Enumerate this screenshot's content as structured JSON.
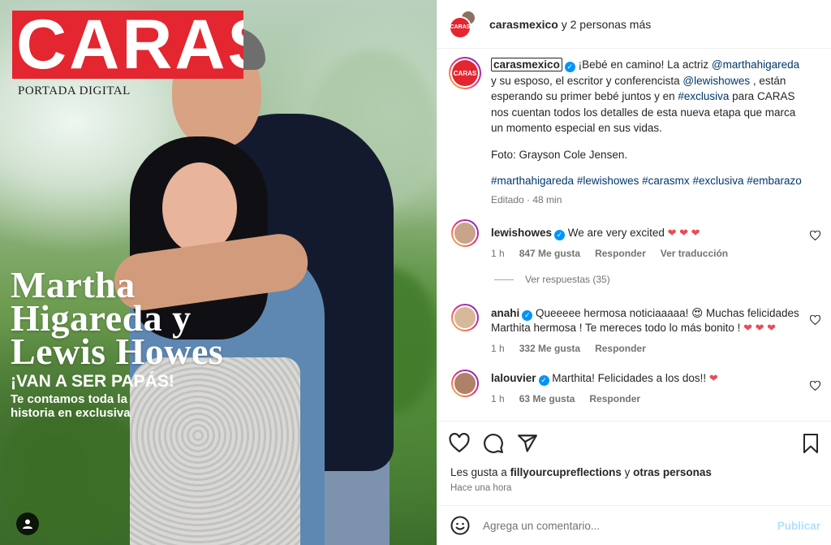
{
  "cover": {
    "brand": "CARAS",
    "edition": "PORTADA DIGITAL",
    "headline_lines": [
      "Martha",
      "Higareda y",
      "Lewis Howes"
    ],
    "subheadline": "¡VAN A SER PAPÁS!",
    "tagline": "Te contamos toda la historia en exclusiva"
  },
  "header": {
    "avatar_text": "CARAS",
    "account": "carasmexico",
    "rest": " y 2 personas más"
  },
  "caption": {
    "avatar_text": "CARAS",
    "username": "carasmexico",
    "text_1": "¡Bebé en camino! La actriz ",
    "mention_1": "@marthahigareda",
    "text_2": " y su esposo, el escritor y conferencista ",
    "mention_2": "@lewishowes",
    "text_3": " , están esperando su primer bebé juntos y en ",
    "hashtag_1": "#exclusiva",
    "text_4": " para CARAS nos cuentan todos los detalles de esta nueva etapa que marca un momento especial en sus vidas.",
    "credit": "Foto: Grayson Cole Jensen.",
    "hashtags": [
      "#marthahigareda",
      "#lewishowes",
      "#carasmx",
      "#exclusiva",
      "#embarazo"
    ],
    "meta": "Editado · 48 min"
  },
  "comments": [
    {
      "username": "lewishowes",
      "text": "We are very excited",
      "emojis": "❤ ❤ ❤",
      "time": "1 h",
      "likes": "847 Me gusta",
      "reply": "Responder",
      "translate": "Ver traducción",
      "avatar_color": "#c9a48a"
    },
    {
      "username": "anahi",
      "text": "Queeeee hermosa noticiaaaaa! 😍 Muchas felicidades Marthita hermosa ! Te mereces todo lo más bonito ! ",
      "emojis": "❤ ❤ ❤",
      "time": "1 h",
      "likes": "332 Me gusta",
      "reply": "Responder",
      "avatar_color": "#d8b89a"
    },
    {
      "username": "lalouvier",
      "text": "Marthita! Felicidades a los dos!! ",
      "emojis": "❤",
      "time": "1 h",
      "likes": "63 Me gusta",
      "reply": "Responder",
      "avatar_color": "#b08068"
    }
  ],
  "replies_toggle": "Ver respuestas (35)",
  "actions": {
    "likes_prefix": "Les gusta a ",
    "likes_user": "fillyourcupreflections",
    "likes_suffix": " y ",
    "likes_others": "otras personas",
    "time_ago": "Hace una hora"
  },
  "composer": {
    "placeholder": "Agrega un comentario...",
    "post_label": "Publicar"
  },
  "colors": {
    "brand_red": "#e3262f",
    "link": "#00376b",
    "verified": "#0095f6",
    "heart": "#ed4956",
    "post_disabled": "#b2dffc"
  }
}
